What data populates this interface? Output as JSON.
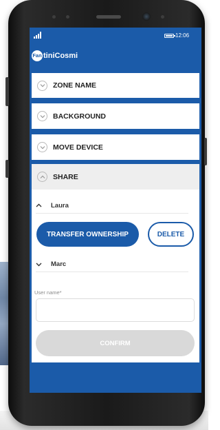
{
  "status_bar": {
    "time": "12:06"
  },
  "app": {
    "logo_mark": "Fan",
    "logo_text": "tiniCosmi"
  },
  "sections": [
    {
      "label": "ZONE NAME",
      "icon": "chevron-down-icon"
    },
    {
      "label": "BACKGROUND",
      "icon": "chevron-down-icon"
    },
    {
      "label": "MOVE DEVICE",
      "icon": "chevron-down-icon"
    }
  ],
  "share": {
    "label": "SHARE",
    "icon": "chevron-up-icon",
    "users": [
      {
        "name": "Laura",
        "expanded": true
      },
      {
        "name": "Marc",
        "expanded": false
      }
    ],
    "transfer_label": "TRANSFER OWNERSHIP",
    "delete_label": "DELETE",
    "user_name_label": "User name*",
    "user_name_value": "",
    "confirm_label": "CONFIRM"
  },
  "colors": {
    "brand": "#1b5ba9",
    "header_bg": "#eeeeee",
    "confirm_disabled": "#d9d9d9"
  }
}
